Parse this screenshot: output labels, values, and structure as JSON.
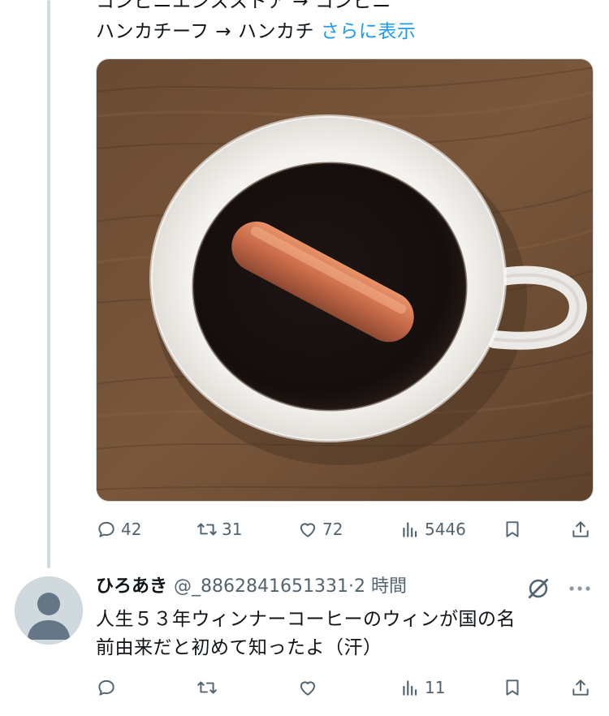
{
  "tweet": {
    "text_line_1": "コンビニエンスストア → コンビニ",
    "text_line_2": "ハンカチーフ → ハンカチ",
    "show_more": "さらに表示",
    "actions": {
      "replies": "42",
      "reposts": "31",
      "likes": "72",
      "views": "5446"
    }
  },
  "reply": {
    "name": "ひろあき",
    "handle": "@_8862841651331",
    "separator": "·",
    "time": "2 時間",
    "text": "人生５３年ウィンナーコーヒーのウィンが国の名\n前由来だと初めて知ったよ（汗）",
    "actions": {
      "views": "11"
    }
  },
  "icons": {
    "reply": "speech-bubble-icon",
    "repost": "repost-arrows-icon",
    "like": "heart-icon",
    "views": "bar-chart-icon",
    "bookmark": "bookmark-icon",
    "share": "share-upload-icon",
    "grok": "grok-icon",
    "more": "more-dots-icon",
    "avatar": "default-avatar-icon"
  },
  "colors": {
    "link": "#1d9bf0",
    "secondary_text": "#536471",
    "thread_line": "#cfd9de"
  }
}
